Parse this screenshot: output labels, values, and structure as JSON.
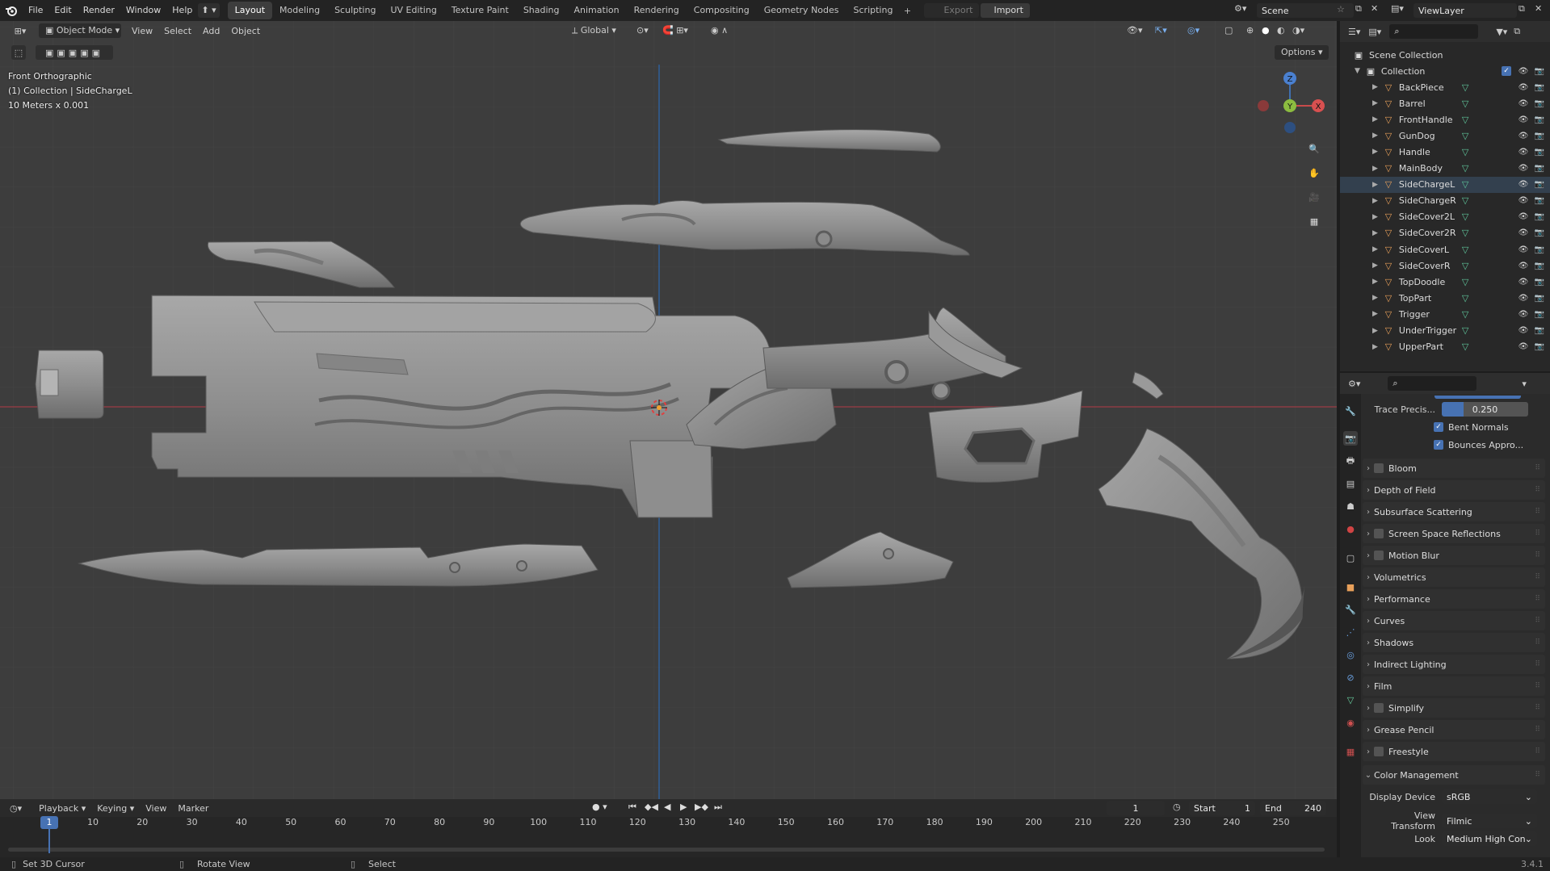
{
  "topbar": {
    "menus": [
      "File",
      "Edit",
      "Render",
      "Window",
      "Help"
    ],
    "workspaces": [
      "Layout",
      "Modeling",
      "Sculpting",
      "UV Editing",
      "Texture Paint",
      "Shading",
      "Animation",
      "Rendering",
      "Compositing",
      "Geometry Nodes",
      "Scripting"
    ],
    "active_workspace": "Layout",
    "export_label": "Export",
    "import_label": "Import",
    "scene_name": "Scene",
    "view_layer": "ViewLayer"
  },
  "viewport": {
    "mode": "Object Mode",
    "menus": [
      "View",
      "Select",
      "Add",
      "Object"
    ],
    "orientation": "Global",
    "options_label": "Options",
    "info": [
      "Front Orthographic",
      "(1) Collection | SideChargeL",
      "10 Meters x 0.001"
    ],
    "gizmo_axes": {
      "z": "Z",
      "y": "Y",
      "x": "X"
    }
  },
  "outliner": {
    "root": "Scene Collection",
    "collection": "Collection",
    "objects": [
      "BackPiece",
      "Barrel",
      "FrontHandle",
      "GunDog",
      "Handle",
      "MainBody",
      "SideChargeL",
      "SideChargeR",
      "SideCover2L",
      "SideCover2R",
      "SideCoverL",
      "SideCoverR",
      "TopDoodle",
      "TopPart",
      "Trigger",
      "UnderTrigger",
      "UpperPart"
    ],
    "selected": "SideChargeL"
  },
  "properties": {
    "trace_precision_label": "Trace Precis...",
    "trace_precision_value": "0.250",
    "bent_normals_label": "Bent Normals",
    "bounces_label": "Bounces Appro...",
    "panels": [
      {
        "label": "Bloom",
        "checkbox": true
      },
      {
        "label": "Depth of Field",
        "checkbox": false
      },
      {
        "label": "Subsurface Scattering",
        "checkbox": false
      },
      {
        "label": "Screen Space Reflections",
        "checkbox": true
      },
      {
        "label": "Motion Blur",
        "checkbox": true
      },
      {
        "label": "Volumetrics",
        "checkbox": false
      },
      {
        "label": "Performance",
        "checkbox": false
      },
      {
        "label": "Curves",
        "checkbox": false
      },
      {
        "label": "Shadows",
        "checkbox": false
      },
      {
        "label": "Indirect Lighting",
        "checkbox": false
      },
      {
        "label": "Film",
        "checkbox": false
      },
      {
        "label": "Simplify",
        "checkbox": true
      },
      {
        "label": "Grease Pencil",
        "checkbox": false
      },
      {
        "label": "Freestyle",
        "checkbox": true
      }
    ],
    "color_management_label": "Color Management",
    "display_device_label": "Display Device",
    "display_device_value": "sRGB",
    "view_transform_label": "View Transform",
    "view_transform_value": "Filmic",
    "look_label": "Look",
    "look_value": "Medium High Con..."
  },
  "timeline": {
    "menus": [
      "Playback",
      "Keying",
      "View",
      "Marker"
    ],
    "current_frame": "1",
    "start_label": "Start",
    "start_value": "1",
    "end_label": "End",
    "end_value": "240",
    "ticks": [
      "10",
      "20",
      "30",
      "40",
      "50",
      "60",
      "70",
      "80",
      "90",
      "100",
      "110",
      "120",
      "130",
      "140",
      "150",
      "160",
      "170",
      "180",
      "190",
      "200",
      "210",
      "220",
      "230",
      "240",
      "250"
    ],
    "playhead_label": "1"
  },
  "statusbar": {
    "left": "Set 3D Cursor",
    "middle": "Rotate View",
    "right": "Select",
    "version": "3.4.1"
  }
}
